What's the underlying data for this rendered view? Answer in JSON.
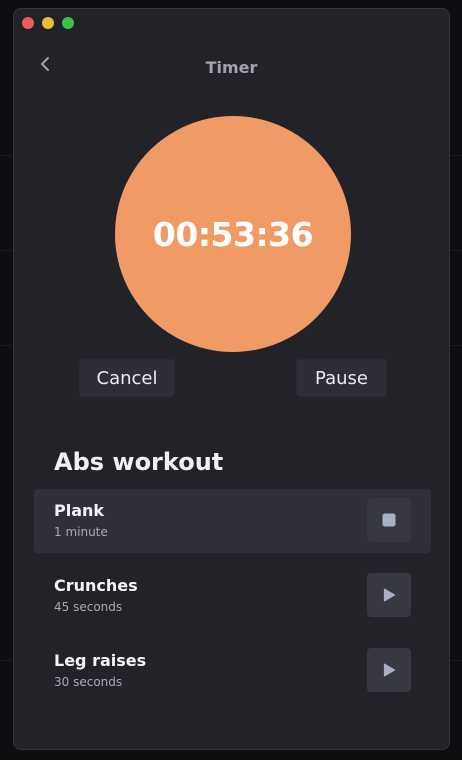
{
  "window": {
    "title": "Timer"
  },
  "timer": {
    "display": "00:53:36",
    "accent_color": "#f09a66"
  },
  "controls": {
    "cancel_label": "Cancel",
    "pause_label": "Pause"
  },
  "workout": {
    "title": "Abs workout",
    "exercises": [
      {
        "name": "Plank",
        "duration": "1 minute",
        "state": "active",
        "action_icon": "stop-icon"
      },
      {
        "name": "Crunches",
        "duration": "45 seconds",
        "state": "idle",
        "action_icon": "play-icon"
      },
      {
        "name": "Leg raises",
        "duration": "30 seconds",
        "state": "idle",
        "action_icon": "play-icon"
      }
    ]
  },
  "traffic_lights": [
    "#ec5e56",
    "#f2b83a",
    "#38c34a"
  ]
}
